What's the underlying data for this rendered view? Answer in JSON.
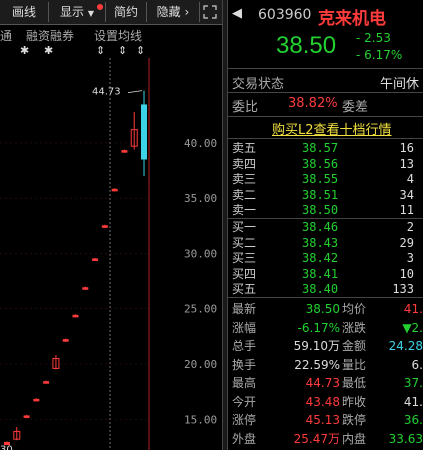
{
  "toolbar": {
    "draw": "画线",
    "show": "显示",
    "simple": "简约",
    "hide": "隐藏"
  },
  "chart_toolbar": {
    "margin": "融资融券",
    "ma_settings": "设置均线",
    "left_partial": "通"
  },
  "chart_data": {
    "type": "candlestick",
    "y_ticks": [
      "40.00",
      "35.00",
      "30.00",
      "25.00",
      "20.00",
      "15.00"
    ],
    "y_tick_values": [
      40,
      35,
      30,
      25,
      20,
      15
    ],
    "ylim": [
      12.4,
      47.5
    ],
    "high_annotation": "44.73",
    "low_annotation": "30",
    "candles": [
      {
        "o": 12.9,
        "h": 13.0,
        "l": 12.7,
        "c": 12.7,
        "color": "red"
      },
      {
        "o": 13.2,
        "h": 14.3,
        "l": 13.1,
        "c": 13.9,
        "color": "red"
      },
      {
        "o": 15.2,
        "h": 15.4,
        "l": 15.1,
        "c": 15.3,
        "color": "red"
      },
      {
        "o": 16.7,
        "h": 16.9,
        "l": 16.6,
        "c": 16.8,
        "color": "red"
      },
      {
        "o": 18.3,
        "h": 18.5,
        "l": 18.2,
        "c": 18.4,
        "color": "red"
      },
      {
        "o": 19.6,
        "h": 20.8,
        "l": 19.5,
        "c": 20.5,
        "color": "red"
      },
      {
        "o": 22.1,
        "h": 22.3,
        "l": 22.0,
        "c": 22.2,
        "color": "red"
      },
      {
        "o": 24.3,
        "h": 24.5,
        "l": 24.2,
        "c": 24.4,
        "color": "red"
      },
      {
        "o": 26.8,
        "h": 27.0,
        "l": 26.7,
        "c": 26.9,
        "color": "red"
      },
      {
        "o": 29.5,
        "h": 29.6,
        "l": 29.4,
        "c": 29.5,
        "color": "red"
      },
      {
        "o": 32.4,
        "h": 32.6,
        "l": 32.3,
        "c": 32.5,
        "color": "red"
      },
      {
        "o": 35.7,
        "h": 35.9,
        "l": 35.6,
        "c": 35.8,
        "color": "red"
      },
      {
        "o": 39.2,
        "h": 39.4,
        "l": 39.1,
        "c": 39.3,
        "color": "red"
      },
      {
        "o": 39.7,
        "h": 42.8,
        "l": 39.4,
        "c": 41.2,
        "color": "red"
      },
      {
        "o": 43.48,
        "h": 44.73,
        "l": 37.0,
        "c": 38.5,
        "color": "cyan"
      }
    ]
  },
  "quote": {
    "code": "603960",
    "name": "克来机电",
    "price": "38.50",
    "change": "- 2.53",
    "change_pct": "- 6.17%"
  },
  "trade_status": {
    "label": "交易状态",
    "value": "午间休"
  },
  "ratio": {
    "label": "委比",
    "value": "38.82%",
    "diff_label": "委差"
  },
  "buy_l2": "购买L2查看十档行情",
  "asks": [
    {
      "name": "卖五",
      "price": "38.57",
      "vol": "16"
    },
    {
      "name": "卖四",
      "price": "38.56",
      "vol": "13"
    },
    {
      "name": "卖三",
      "price": "38.55",
      "vol": "4"
    },
    {
      "name": "卖二",
      "price": "38.51",
      "vol": "34"
    },
    {
      "name": "卖一",
      "price": "38.50",
      "vol": "11"
    }
  ],
  "bids": [
    {
      "name": "买一",
      "price": "38.46",
      "vol": "2"
    },
    {
      "name": "买二",
      "price": "38.43",
      "vol": "29"
    },
    {
      "name": "买三",
      "price": "38.42",
      "vol": "3"
    },
    {
      "name": "买四",
      "price": "38.41",
      "vol": "10"
    },
    {
      "name": "买五",
      "price": "38.40",
      "vol": "133"
    }
  ],
  "stats": [
    {
      "l1": "最新",
      "v1": "38.50",
      "c1": "grn",
      "l2": "均价",
      "v2": "41.",
      "c2": "red"
    },
    {
      "l1": "涨幅",
      "v1": "-6.17%",
      "c1": "grn",
      "l2": "涨跌",
      "v2": "▼2.",
      "c2": "grn"
    },
    {
      "l1": "总手",
      "v1": "59.10万",
      "c1": "wht",
      "l2": "金额",
      "v2": "24.28",
      "c2": "cyn"
    },
    {
      "l1": "换手",
      "v1": "22.59%",
      "c1": "wht",
      "l2": "量比",
      "v2": "6.",
      "c2": "wht"
    },
    {
      "l1": "最高",
      "v1": "44.73",
      "c1": "red",
      "l2": "最低",
      "v2": "37.",
      "c2": "grn"
    },
    {
      "l1": "今开",
      "v1": "43.48",
      "c1": "red",
      "l2": "昨收",
      "v2": "41.",
      "c2": "wht"
    },
    {
      "l1": "涨停",
      "v1": "45.13",
      "c1": "red",
      "l2": "跌停",
      "v2": "36.",
      "c2": "grn"
    },
    {
      "l1": "外盘",
      "v1": "25.47万",
      "c1": "red",
      "l2": "内盘",
      "v2": "33.63",
      "c2": "grn"
    }
  ],
  "colors": {
    "up": "#ff3b3b",
    "down": "#22d030",
    "cyan": "#3cd3e6"
  }
}
